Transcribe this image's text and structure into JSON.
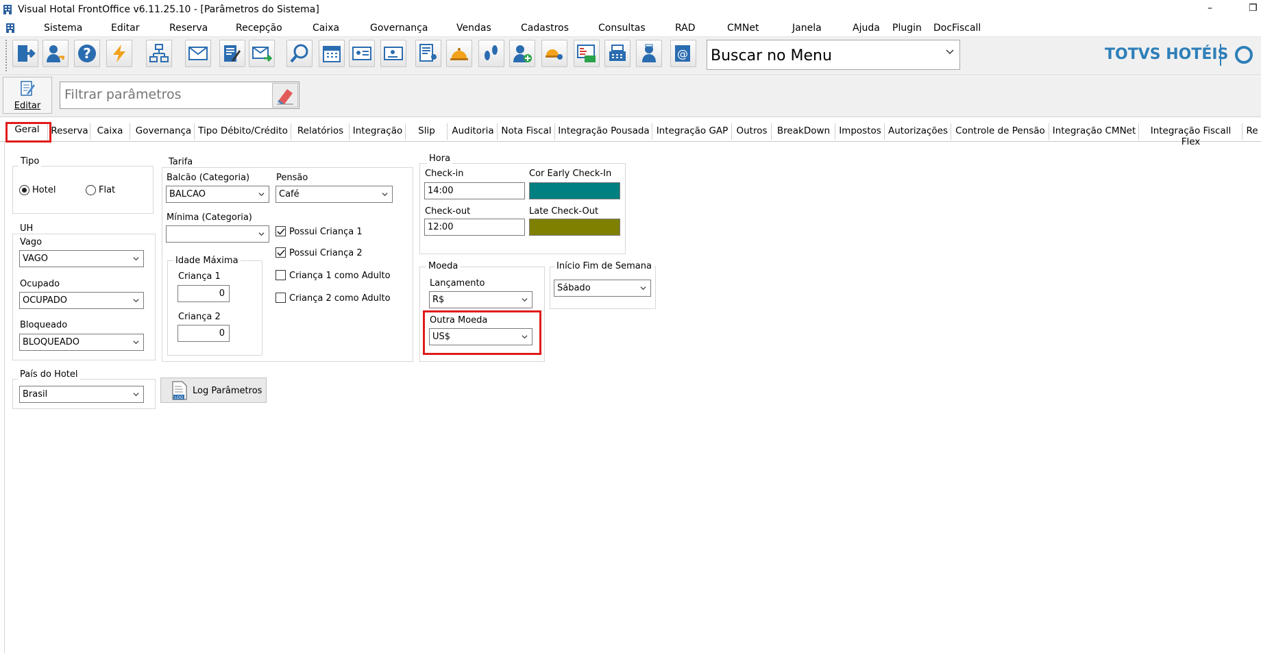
{
  "window": {
    "title": "Visual Hotal FrontOffice v6.11.25.10 - [Parâmetros do Sistema]",
    "minimize": "–",
    "restore": "❐"
  },
  "menu": [
    "Sistema",
    "Editar",
    "Reserva",
    "Recepção",
    "Caixa",
    "Governança",
    "Vendas",
    "Cadastros",
    "Consultas",
    "RAD",
    "CMNet",
    "Janela",
    "Ajuda",
    "Plugin",
    "DocFiscall"
  ],
  "toolbar": {
    "search_menu": "Buscar no Menu",
    "brand": "TOTVS HOTÉIS"
  },
  "filter": {
    "edit_label": "Editar",
    "placeholder": "Filtrar parâmetros"
  },
  "tabs": [
    "Geral",
    "Reserva",
    "Caixa",
    "Governança",
    "Tipo Débito/Crédito",
    "Relatórios",
    "Integração",
    "Slip",
    "Auditoria",
    "Nota Fiscal",
    "Integração Pousada",
    "Integração GAP",
    "Outros",
    "BreakDown",
    "Impostos",
    "Autorizações",
    "Controle de Pensão",
    "Integração CMNet",
    "Integração Fiscall Flex",
    "Re"
  ],
  "tipo": {
    "title": "Tipo",
    "hotel": "Hotel",
    "flat": "Flat"
  },
  "uh": {
    "title": "UH",
    "vago_label": "Vago",
    "vago_value": "VAGO",
    "ocupado_label": "Ocupado",
    "ocupado_value": "OCUPADO",
    "bloqueado_label": "Bloqueado",
    "bloqueado_value": "BLOQUEADO"
  },
  "pais": {
    "title": "País do Hotel",
    "value": "Brasil"
  },
  "tarifa": {
    "title": "Tarifa",
    "balcao_label": "Balcão (Categoria)",
    "balcao_value": "BALCAO",
    "pensao_label": "Pensão",
    "pensao_value": "Café",
    "minima_label": "Mínima (Categoria)",
    "minima_value": "",
    "idade_title": "Idade Máxima",
    "crianca1_label": "Criança 1",
    "crianca1_value": "0",
    "crianca2_label": "Criança 2",
    "crianca2_value": "0",
    "possui_crianca1": "Possui Criança 1",
    "possui_crianca2": "Possui Criança 2",
    "crianca1_adulto": "Criança 1 como Adulto",
    "crianca2_adulto": "Criança 2 como Adulto"
  },
  "log_button": "Log Parâmetros",
  "hora": {
    "title": "Hora",
    "checkin_label": "Check-in",
    "checkin_value": "14:00",
    "early_label": "Cor Early Check-In",
    "early_color": "#008080",
    "checkout_label": "Check-out",
    "checkout_value": "12:00",
    "late_label": "Late Check-Out",
    "late_color": "#808000"
  },
  "moeda": {
    "title": "Moeda",
    "lancamento_label": "Lançamento",
    "lancamento_value": "R$",
    "outra_label": "Outra Moeda",
    "outra_value": "US$"
  },
  "fim_semana": {
    "title": "Início Fim de Semana",
    "value": "Sábado"
  }
}
